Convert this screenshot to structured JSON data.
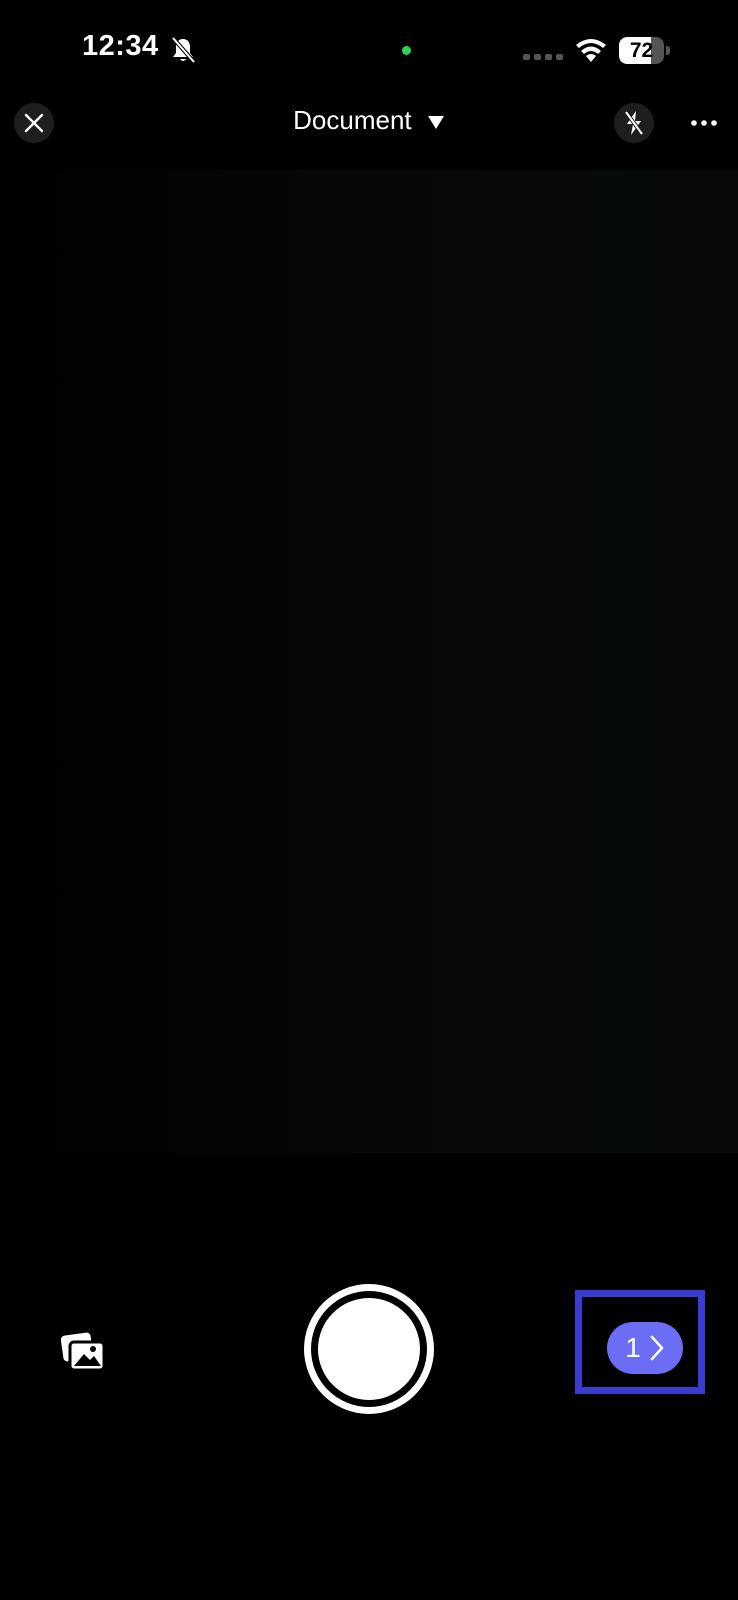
{
  "status_bar": {
    "time": "12:34",
    "battery_level": "72",
    "battery_fraction": 0.72,
    "icons": [
      "bell-slash-icon",
      "mic-indicator-dot",
      "signal-icon",
      "wifi-icon",
      "battery-icon"
    ],
    "mic_indicator_color": "#30d158"
  },
  "top_bar": {
    "close_icon": "close-icon",
    "mode_label": "Document",
    "mode_caret_icon": "caret-down-icon",
    "flash_icon": "flash-off-icon",
    "more_icon": "more-horizontal-icon"
  },
  "bottom_controls": {
    "gallery_icon": "gallery-icon",
    "shutter_icon": "shutter-button",
    "pages_count": "1",
    "pages_chevron_icon": "chevron-right-icon",
    "pages_button_color": "#6b6df5",
    "highlight_color": "#3a3ccf"
  }
}
